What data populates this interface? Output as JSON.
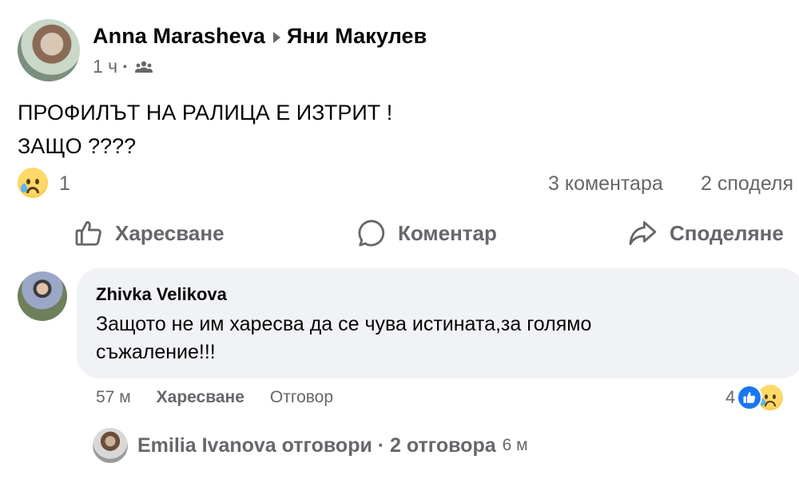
{
  "post": {
    "author": "Anna Marasheva",
    "target": "Яни Макулев",
    "time": "1 ч",
    "audience_icon": "friends-icon",
    "text_line1": "ПРОФИЛЪТ НА РАЛИЦА Е ИЗТРИТ !",
    "text_line2": "ЗАЩО ????"
  },
  "reactions": {
    "icon": "sad-reaction-icon",
    "count": "1",
    "comments": "3 коментара",
    "shares": "2 споделя"
  },
  "actions": {
    "like": "Харесване",
    "comment": "Коментар",
    "share": "Споделяне"
  },
  "comment": {
    "author": "Zhivka Velikova",
    "text_line1": "Защото не им харесва да се чува истината,за голямо",
    "text_line2": "съжаление!!!",
    "time": "57 м",
    "like_label": "Харесване",
    "reply_label": "Отговор",
    "reaction_count": "4"
  },
  "replies": {
    "text": "Emilia Ivanova отговори · 2 отговора",
    "time": "6 м"
  },
  "colors": {
    "secondary_text": "#65676b",
    "bubble": "#f0f2f5",
    "like_blue": "#1877f2"
  }
}
